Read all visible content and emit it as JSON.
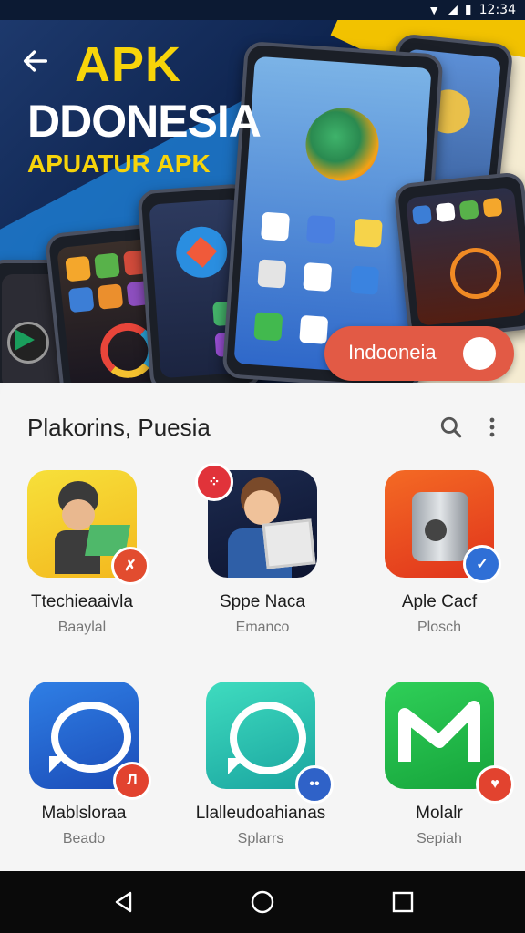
{
  "status_bar": {
    "time": "12:34"
  },
  "banner": {
    "title_line1": "APK",
    "title_line2": "DDONESIA",
    "title_line3": "APUATUR APK",
    "toggle_label": "Indooneia"
  },
  "section": {
    "title": "Plakorins, Puesia"
  },
  "apps": [
    {
      "name": "Ttechieaaivla",
      "subtitle": "Baaylal"
    },
    {
      "name": "Sppe Naca",
      "subtitle": "Emanco"
    },
    {
      "name": "Aple Cacf",
      "subtitle": "Plosch"
    },
    {
      "name": "Mablsloraa",
      "subtitle": "Beado"
    },
    {
      "name": "Llalleudoahianas",
      "subtitle": "Splarrs"
    },
    {
      "name": "Molalr",
      "subtitle": "Sepiah"
    }
  ],
  "badges": {
    "app1": "",
    "app2": "",
    "app3": "✓",
    "app4": "Л",
    "app5": "••",
    "app6": "♥"
  },
  "colors": {
    "accent_red": "#e25a45",
    "banner_yellow": "#f7d40a",
    "banner_blue": "#0f2550"
  },
  "icons": {
    "back": "arrow-left-icon",
    "search": "search-icon",
    "more": "more-vertical-icon",
    "nav_back": "triangle-back-icon",
    "nav_home": "circle-home-icon",
    "nav_recents": "square-recents-icon"
  }
}
